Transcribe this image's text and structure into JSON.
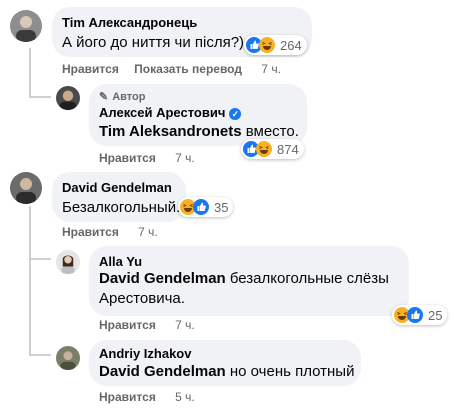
{
  "actions": {
    "like": "Нравится",
    "translate": "Показать перевод"
  },
  "comments": [
    {
      "author": "Tim Александронець",
      "text": "А його до ниття чи після?)",
      "time": "7 ч.",
      "reactions": "264"
    },
    {
      "badge": "Автор",
      "author": "Алексей Арестович",
      "mention": "Tim Aleksandronets",
      "text": " вместо.",
      "time": "7 ч.",
      "reactions": "874"
    },
    {
      "author": "David Gendelman",
      "text": "Безалкогольный.",
      "time": "7 ч.",
      "reactions": "35"
    },
    {
      "author": "Alla Yu",
      "mention": "David Gendelman",
      "text": " безалкогольные слёзы Арестовича.",
      "time": "7 ч.",
      "reactions": "25"
    },
    {
      "author": "Andriy Izhakov",
      "mention": "David Gendelman",
      "text": " но очень плотный",
      "time": "5 ч."
    }
  ]
}
